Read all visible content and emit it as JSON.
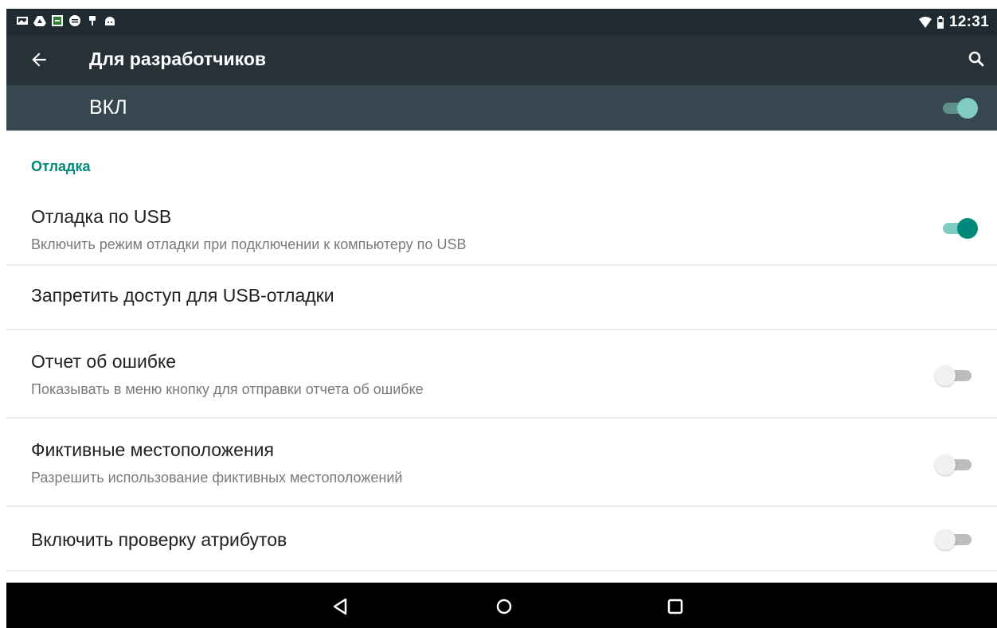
{
  "status_bar": {
    "time": "12:31",
    "left_icons": [
      "gallery-icon",
      "drive-icon",
      "screenshot-icon",
      "media-icon",
      "usb-icon",
      "android-icon"
    ],
    "right_icons": [
      "wifi-icon",
      "battery-icon"
    ]
  },
  "app_bar": {
    "title": "Для разработчиков"
  },
  "master_switch": {
    "label": "ВКЛ",
    "state": "on"
  },
  "section": {
    "header": "Отладка"
  },
  "settings": [
    {
      "title": "Отладка по USB",
      "subtitle": "Включить режим отладки при подключении к компьютеру по USB",
      "switch": "on"
    },
    {
      "title": "Запретить доступ для USB-отладки",
      "subtitle": "",
      "switch": "none"
    },
    {
      "title": "Отчет об ошибке",
      "subtitle": "Показывать в меню кнопку для отправки отчета об ошибке",
      "switch": "off"
    },
    {
      "title": "Фиктивные местоположения",
      "subtitle": "Разрешить использование фиктивных местоположений",
      "switch": "off"
    },
    {
      "title": "Включить проверку атрибутов",
      "subtitle": "",
      "switch": "off"
    }
  ],
  "navigation": [
    "back-icon",
    "home-icon",
    "recents-icon"
  ],
  "colors": {
    "accent": "#00897b",
    "accent_light": "#80cbc4",
    "master_accent": "#80cbc4",
    "appbar": "#263238",
    "masterbar": "#37474f",
    "switch_off_thumb": "#f1f1f1",
    "switch_off_track": "#bdbdbd"
  }
}
